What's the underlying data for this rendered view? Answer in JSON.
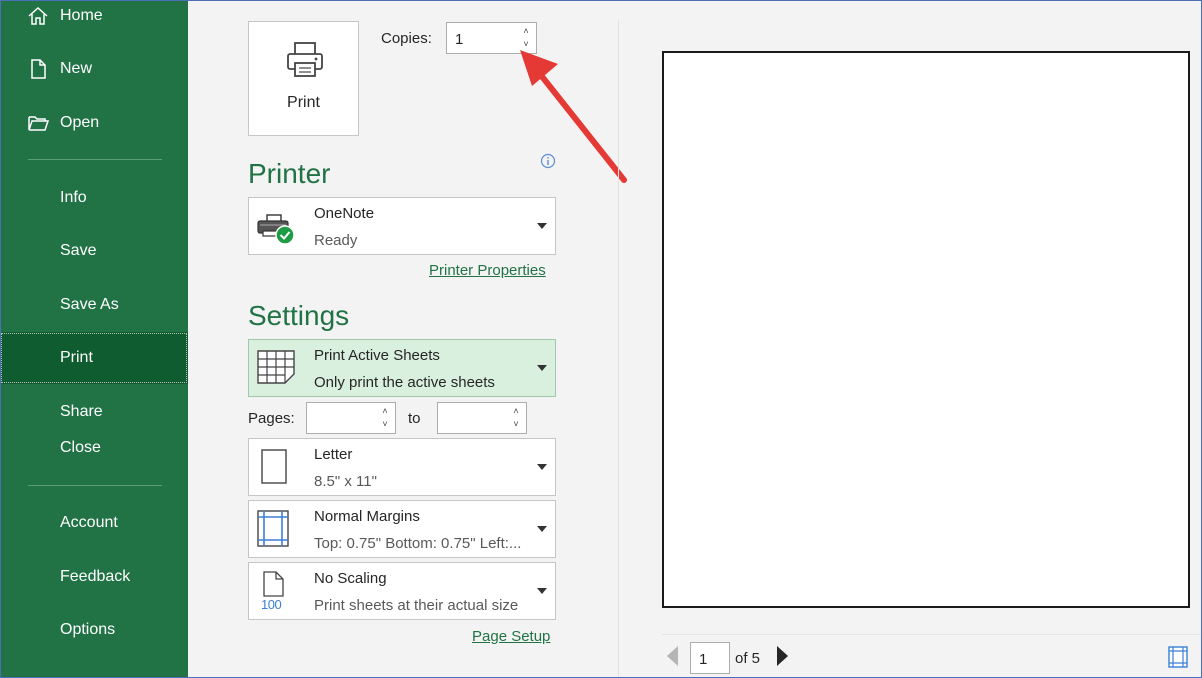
{
  "sidebar": {
    "items": [
      {
        "label": "Home",
        "icon": "home-icon"
      },
      {
        "label": "New",
        "icon": "new-document-icon"
      },
      {
        "label": "Open",
        "icon": "open-folder-icon"
      },
      {
        "label": "Info"
      },
      {
        "label": "Save"
      },
      {
        "label": "Save As"
      },
      {
        "label": "Print",
        "active": true
      },
      {
        "label": "Share"
      },
      {
        "label": "Close"
      },
      {
        "label": "Account"
      },
      {
        "label": "Feedback"
      },
      {
        "label": "Options"
      }
    ]
  },
  "print": {
    "button_label": "Print",
    "copies_label": "Copies:",
    "copies_value": "1"
  },
  "printer": {
    "title": "Printer",
    "name": "OneNote",
    "status": "Ready",
    "properties_link": "Printer Properties"
  },
  "settings": {
    "title": "Settings",
    "scope": {
      "main": "Print Active Sheets",
      "sub": "Only print the active sheets"
    },
    "pages_label": "Pages:",
    "pages_from": "",
    "to_label": "to",
    "pages_to": "",
    "paper": {
      "main": "Letter",
      "sub": "8.5\" x 11\""
    },
    "margins": {
      "main": "Normal Margins",
      "sub": "Top: 0.75\" Bottom: 0.75\" Left:..."
    },
    "scaling": {
      "main": "No Scaling",
      "sub": "Print sheets at their actual size",
      "icon_text": "100"
    },
    "page_setup_link": "Page Setup"
  },
  "preview": {
    "current_page": "1",
    "of_label": "of 5"
  },
  "colors": {
    "sidebar": "#217346",
    "sidebar_active": "#0e5c2f",
    "accent": "#217346",
    "annotation_arrow": "#e53935"
  }
}
